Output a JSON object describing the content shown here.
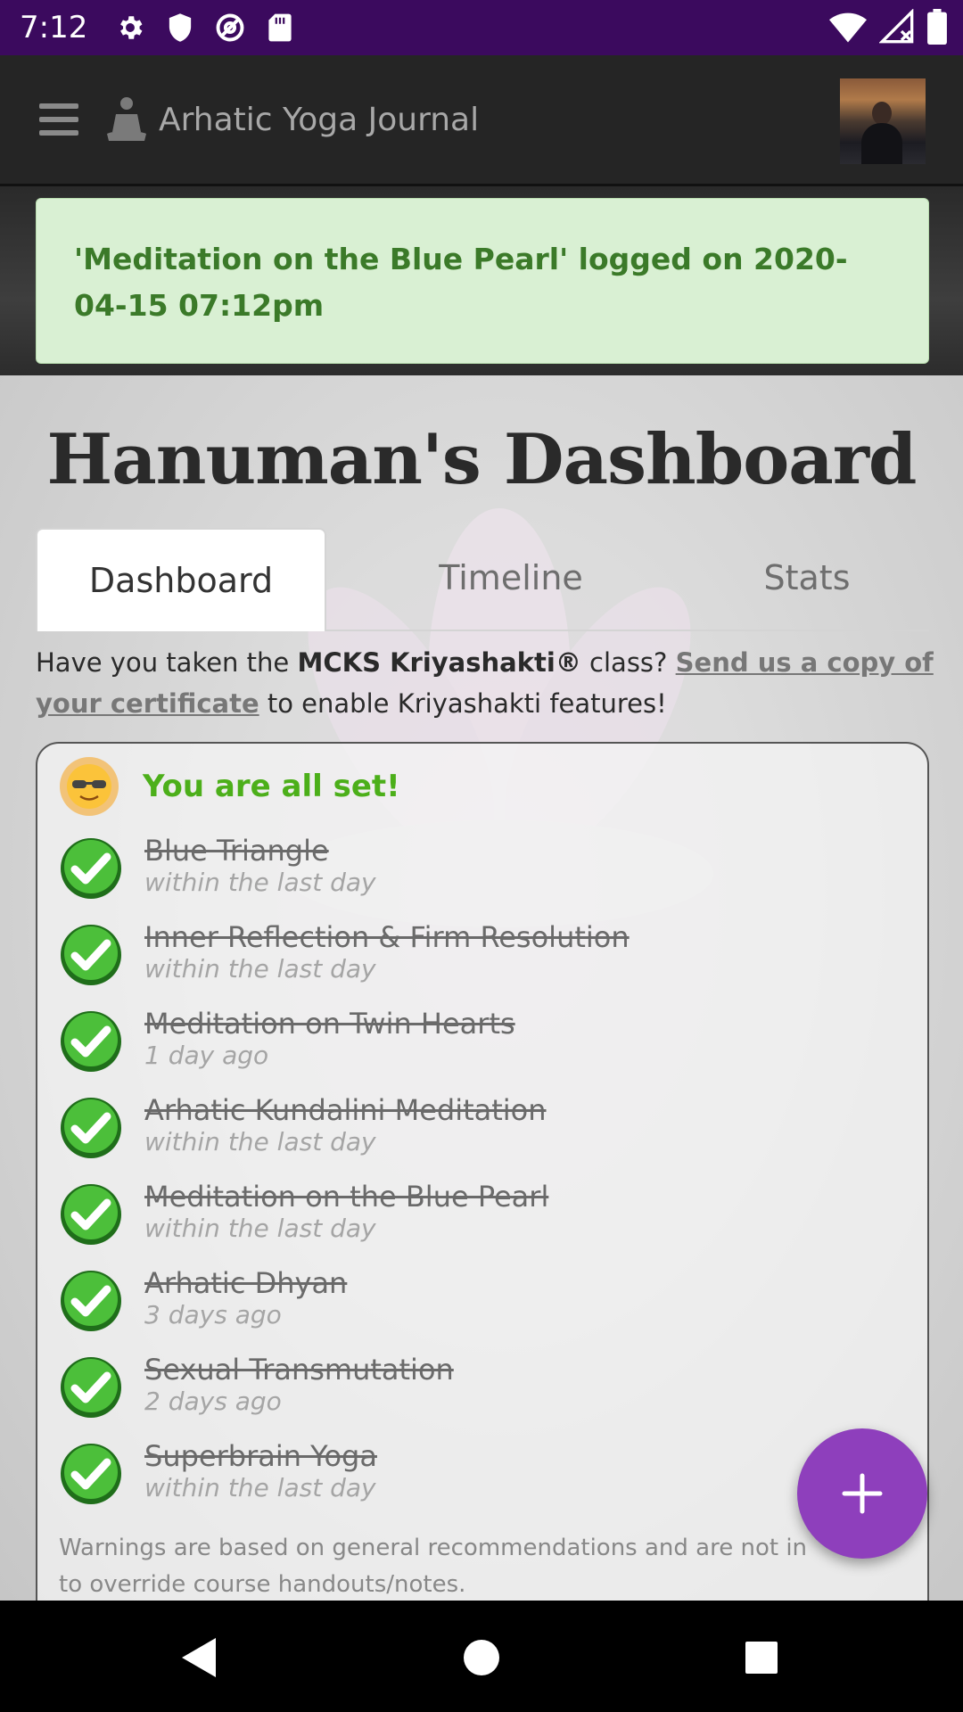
{
  "status_bar": {
    "time": "7:12",
    "icons": [
      "settings-icon",
      "shield-icon",
      "at-sign-icon",
      "sd-card-icon",
      "wifi-icon",
      "signal-icon",
      "battery-icon"
    ]
  },
  "app_bar": {
    "title": "Arhatic Yoga Journal",
    "menu_icon": "hamburger-icon",
    "brand_icon": "meditator-icon",
    "avatar": "user-avatar"
  },
  "notice": {
    "text": "'Meditation on the Blue Pearl' logged on 2020-04-15 07:12pm"
  },
  "page": {
    "title": "Hanuman's Dashboard"
  },
  "tabs": [
    {
      "label": "Dashboard",
      "active": true
    },
    {
      "label": "Timeline",
      "active": false
    },
    {
      "label": "Stats",
      "active": false
    }
  ],
  "info": {
    "prefix": "Have you taken the ",
    "course": "MCKS Kriyashakti®",
    "middle": " class? ",
    "link": "Send us a copy of your certificate",
    "suffix": " to enable Kriyashakti features!"
  },
  "checklist": {
    "heading": "You are all set!",
    "items": [
      {
        "name": "Blue Triangle",
        "when": "within the last day"
      },
      {
        "name": "Inner Reflection & Firm Resolution",
        "when": "within the last day"
      },
      {
        "name": "Meditation on Twin Hearts",
        "when": "1 day ago"
      },
      {
        "name": "Arhatic Kundalini Meditation",
        "when": "within the last day"
      },
      {
        "name": "Meditation on the Blue Pearl",
        "when": "within the last day"
      },
      {
        "name": "Arhatic Dhyan",
        "when": "3 days ago"
      },
      {
        "name": "Sexual Transmutation",
        "when": "2 days ago"
      },
      {
        "name": "Superbrain Yoga",
        "when": "within the last day"
      }
    ],
    "warning": "Warnings are based on general recommendations and are not in to override course handouts/notes."
  },
  "colors": {
    "status_bar": "#3b0a5e",
    "app_bar": "#252525",
    "notice_bg": "#d9f0d3",
    "notice_text": "#3b7a29",
    "all_set": "#4caf1a",
    "fab": "#8e3fbc"
  }
}
